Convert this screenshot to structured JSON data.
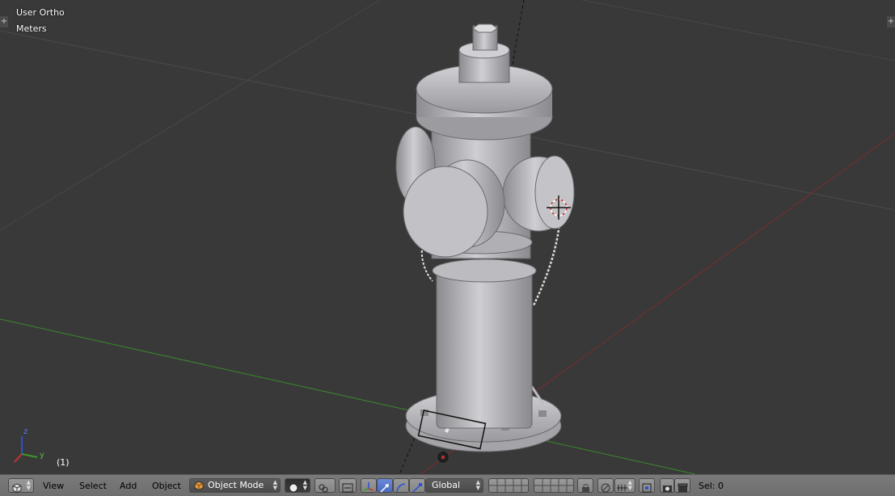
{
  "viewport": {
    "view_name": "User Ortho",
    "units": "Meters",
    "frame_label": "(1)",
    "axis_labels": {
      "z": "z",
      "y": "y"
    },
    "colors": {
      "background": "#393939",
      "x_axis": "#8a2e2e",
      "y_axis": "#3a8a2a",
      "mesh": "#b8b8bc"
    }
  },
  "header": {
    "editor_type_icon": "cube-icon",
    "menus": [
      "View",
      "Select",
      "Add",
      "Object"
    ],
    "mode": {
      "label": "Object Mode",
      "icon": "cube-orange-icon"
    },
    "shading_icon": "solid-sphere-icon",
    "transform_orientation": "Global",
    "status": "Sel: 0"
  }
}
